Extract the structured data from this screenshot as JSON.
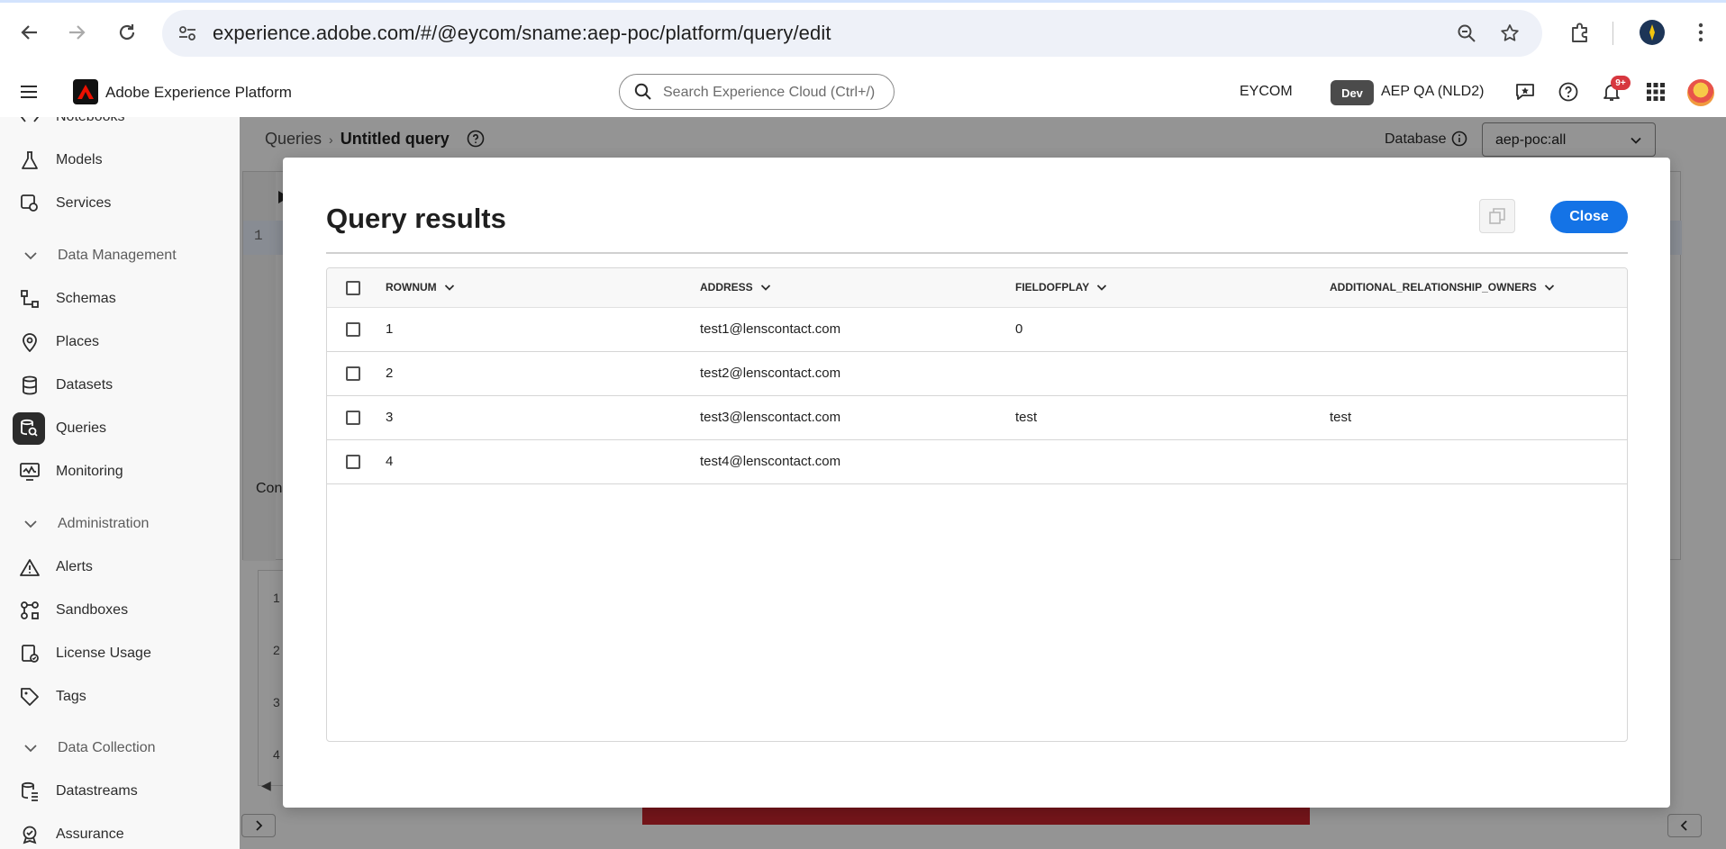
{
  "browser": {
    "url": "experience.adobe.com/#/@eycom/sname:aep-poc/platform/query/edit"
  },
  "header": {
    "app_title": "Adobe Experience Platform",
    "search_placeholder": "Search Experience Cloud (Ctrl+/)",
    "org": "EYCOM",
    "env_badge": "Dev",
    "sandbox": "AEP QA (NLD2)",
    "notification_count": "9+"
  },
  "sidebar": {
    "items": [
      {
        "label": "Notebooks",
        "icon": "notebooks-icon"
      },
      {
        "label": "Models",
        "icon": "flask-icon"
      },
      {
        "label": "Services",
        "icon": "services-icon"
      },
      {
        "section": "Data Management"
      },
      {
        "label": "Schemas",
        "icon": "schema-icon"
      },
      {
        "label": "Places",
        "icon": "pin-icon"
      },
      {
        "label": "Datasets",
        "icon": "database-icon"
      },
      {
        "label": "Queries",
        "icon": "query-icon",
        "active": true
      },
      {
        "label": "Monitoring",
        "icon": "monitoring-icon"
      },
      {
        "section": "Administration"
      },
      {
        "label": "Alerts",
        "icon": "alert-icon"
      },
      {
        "label": "Sandboxes",
        "icon": "sandbox-icon"
      },
      {
        "label": "License Usage",
        "icon": "license-icon"
      },
      {
        "label": "Tags",
        "icon": "tag-icon"
      },
      {
        "section": "Data Collection"
      },
      {
        "label": "Datastreams",
        "icon": "datastream-icon"
      },
      {
        "label": "Assurance",
        "icon": "assurance-icon"
      }
    ]
  },
  "page": {
    "breadcrumb_root": "Queries",
    "breadcrumb_current": "Untitled query",
    "database_label": "Database",
    "database_value": "aep-poc:all",
    "editor_line": "1",
    "console_tab": "Cons",
    "results_rows": [
      "1",
      "2",
      "3",
      "4"
    ]
  },
  "modal": {
    "title": "Query results",
    "close_label": "Close",
    "columns": [
      "ROWNUM",
      "ADDRESS",
      "FIELDOFPLAY",
      "ADDITIONAL_RELATIONSHIP_OWNERS"
    ],
    "rows": [
      [
        "1",
        "test1@lenscontact.com",
        "0",
        ""
      ],
      [
        "2",
        "test2@lenscontact.com",
        "",
        ""
      ],
      [
        "3",
        "test3@lenscontact.com",
        "test",
        "test"
      ],
      [
        "4",
        "test4@lenscontact.com",
        "",
        ""
      ]
    ]
  },
  "colors": {
    "accent": "#1473e6",
    "error": "#c9252d",
    "badge": "#d7373f"
  }
}
